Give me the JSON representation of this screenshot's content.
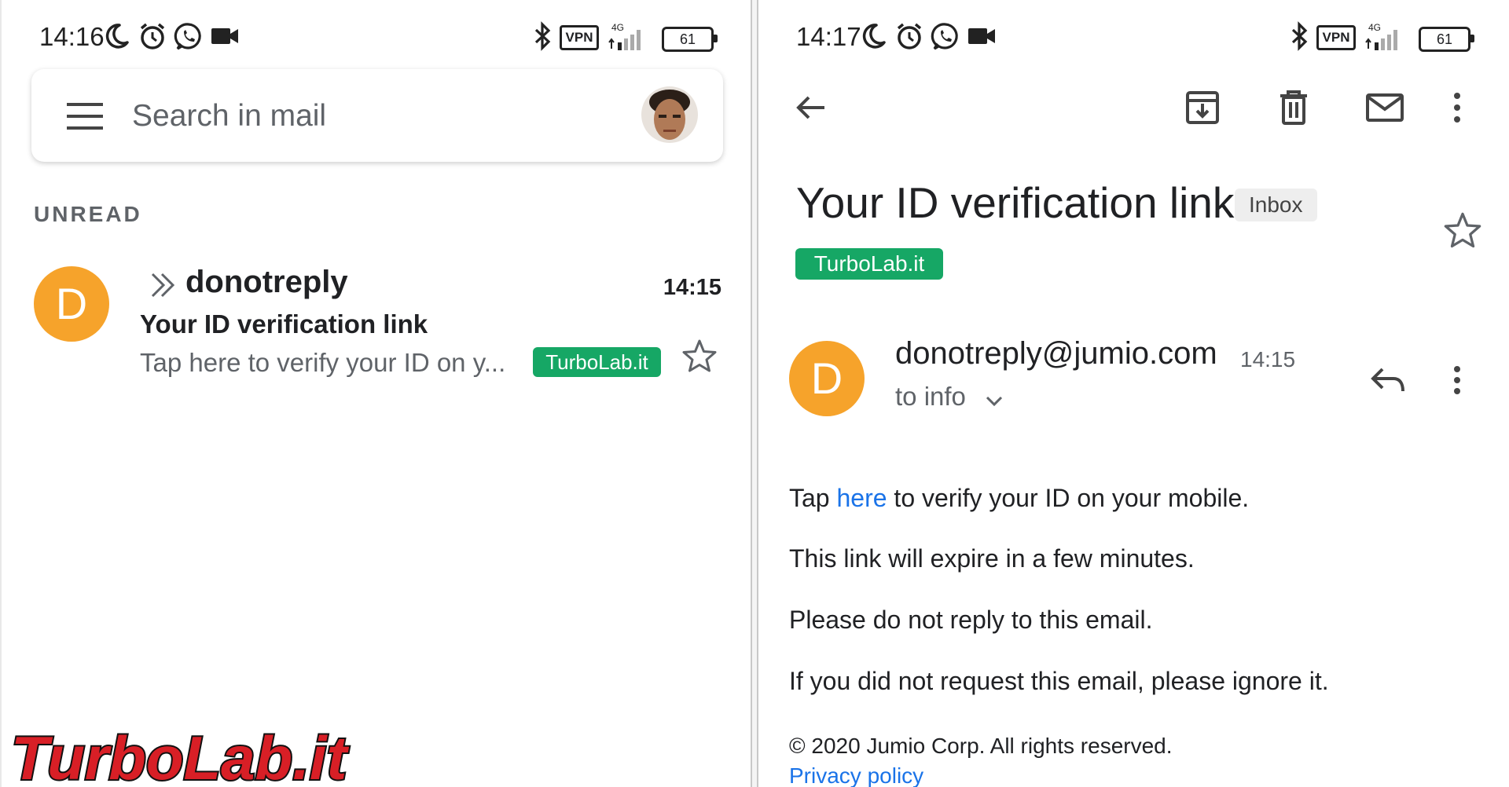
{
  "left": {
    "status": {
      "time": "14:16",
      "vpn": "VPN",
      "network": "4G",
      "battery": "61"
    },
    "search": {
      "placeholder": "Search in mail"
    },
    "section_label": "UNREAD",
    "email_row": {
      "avatar_letter": "D",
      "sender": "donotreply",
      "time": "14:15",
      "subject": "Your ID verification link",
      "snippet": "Tap here to verify your ID on y...",
      "label": "TurboLab.it"
    }
  },
  "right": {
    "status": {
      "time": "14:17",
      "vpn": "VPN",
      "network": "4G",
      "battery": "61"
    },
    "title": "Your ID verification link",
    "inbox_chip": "Inbox",
    "label": "TurboLab.it",
    "sender": {
      "avatar_letter": "D",
      "email": "donotreply@jumio.com",
      "time": "14:15",
      "to": "to info"
    },
    "body": {
      "line1_prefix": "Tap ",
      "line1_link": "here",
      "line1_suffix": " to verify your ID on your mobile.",
      "line2": "This link will expire in a few minutes.",
      "line3": "Please do not reply to this email.",
      "line4": "If you did not request this email, please ignore it."
    },
    "footer": {
      "copyright": "© 2020 Jumio Corp. All rights reserved.",
      "privacy": "Privacy policy"
    }
  },
  "watermark": "TurboLab.it",
  "colors": {
    "label_green": "#16a765",
    "avatar_orange": "#f6a32b",
    "link_blue": "#1a73e8"
  },
  "icons": [
    "moon-icon",
    "alarm-icon",
    "whatsapp-icon",
    "video-icon",
    "bluetooth-icon",
    "menu-icon",
    "chevron-double-icon",
    "star-icon",
    "back-arrow-icon",
    "archive-icon",
    "delete-icon",
    "mail-icon",
    "more-vert-icon",
    "reply-icon",
    "chevron-down-icon"
  ]
}
